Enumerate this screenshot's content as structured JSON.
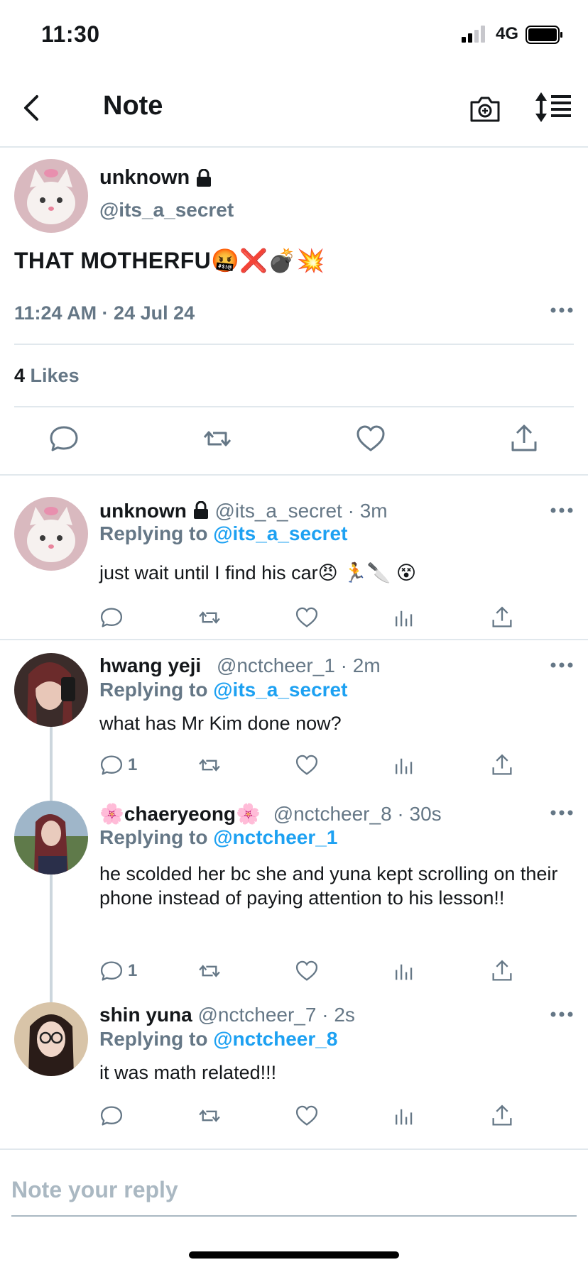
{
  "status_bar": {
    "time": "11:30",
    "network": "4G"
  },
  "nav": {
    "title": "Note"
  },
  "main_note": {
    "name": "unknown",
    "handle": "@its_a_secret",
    "text": "THAT MOTHERFU🤬❌💣💥",
    "timestamp": "11:24 AM · 24 Jul 24",
    "likes_count": "4",
    "likes_label": "Likes"
  },
  "replies": [
    {
      "name": "unknown",
      "meta": "@its_a_secret · 3m",
      "replying_label": "Replying to",
      "replying_to": "@its_a_secret",
      "text": "just wait until I find his car😠 🏃🔪 😵",
      "reply_count": ""
    },
    {
      "name": "hwang yeji",
      "meta": "@nctcheer_1 · 2m",
      "replying_label": "Replying to",
      "replying_to": "@its_a_secret",
      "text": "what has Mr Kim done now?",
      "reply_count": "1"
    },
    {
      "name": "🌸chaeryeong🌸",
      "meta": "@nctcheer_8 · 30s",
      "replying_label": "Replying to",
      "replying_to": "@nctcheer_1",
      "text": "he scolded her bc she and yuna kept scrolling on their phone instead of paying attention to his lesson!!",
      "reply_count": "1"
    },
    {
      "name": "shin yuna",
      "meta": "@nctcheer_7 · 2s",
      "replying_label": "Replying to",
      "replying_to": "@nctcheer_8",
      "text": "it was math related!!!",
      "reply_count": ""
    }
  ],
  "composer": {
    "placeholder": "Note your reply"
  },
  "colors": {
    "accent": "#1da1f2",
    "muted": "#657786",
    "divider": "#e1e8ed"
  }
}
